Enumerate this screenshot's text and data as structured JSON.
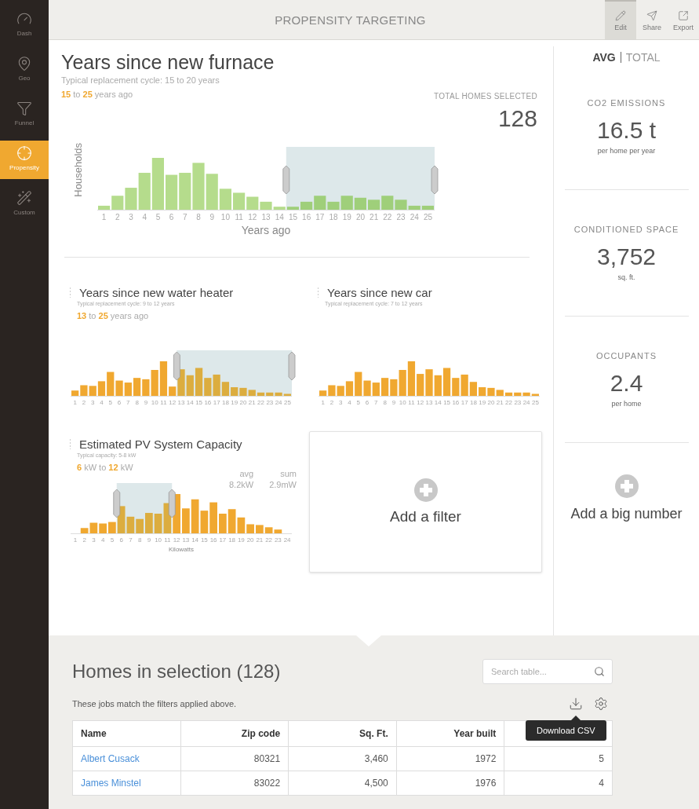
{
  "sidebar": {
    "items": [
      {
        "label": "Dash",
        "kind": "gauge",
        "selected": false
      },
      {
        "label": "Geo",
        "kind": "pin",
        "selected": false
      },
      {
        "label": "Funnel",
        "kind": "funnel",
        "selected": false
      },
      {
        "label": "Propensity",
        "kind": "target",
        "selected": true
      },
      {
        "label": "Custom",
        "kind": "wand",
        "selected": false
      }
    ]
  },
  "header": {
    "title": "PROPENSITY TARGETING",
    "actions": [
      {
        "label": "Edit",
        "kind": "edit",
        "selected": true
      },
      {
        "label": "Share",
        "kind": "share",
        "selected": false
      },
      {
        "label": "Export",
        "kind": "export",
        "selected": false
      }
    ]
  },
  "main_filter": {
    "title": "Years since new furnace",
    "subtitle": "Typical replacement cycle: 15 to 20 years",
    "range": "**15** to **25** years ago",
    "total_label": "TOTAL HOMES SELECTED",
    "total_value": "128",
    "y_axis_label": "Households",
    "x_labels": [
      "1",
      "2",
      "3",
      "4",
      "5",
      "6",
      "7",
      "8",
      "9",
      "10",
      "11",
      "12",
      "13",
      "14",
      "15",
      "16",
      "17",
      "18",
      "19",
      "20",
      "21",
      "22",
      "23",
      "24",
      "25"
    ],
    "x_axis_label": "Years ago"
  },
  "filters": [
    {
      "title": "Years since new water heater",
      "subtitle": "Typical replacement cycle: 9 to 12 years",
      "range": "**13** to **25** years ago",
      "x_labels": [
        "1",
        "2",
        "3",
        "4",
        "5",
        "6",
        "7",
        "8",
        "9",
        "10",
        "11",
        "12",
        "13",
        "14",
        "15",
        "16",
        "17",
        "18",
        "19",
        "20",
        "21",
        "22",
        "23",
        "24",
        "25"
      ]
    },
    {
      "title": "Years since new car",
      "subtitle": "Typical replacement cycle: 7 to 12 years",
      "x_labels": [
        "1",
        "2",
        "3",
        "4",
        "5",
        "6",
        "7",
        "8",
        "9",
        "10",
        "11",
        "12",
        "13",
        "14",
        "15",
        "16",
        "17",
        "18",
        "19",
        "20",
        "21",
        "22",
        "23",
        "24",
        "25"
      ]
    },
    {
      "title": "Estimated PV System Capacity",
      "subtitle": "Typical capacity: 5-8 kW",
      "range": "**6** kW to **12** kW",
      "stats": [
        {
          "label": "avg",
          "value": "8.2kW"
        },
        {
          "label": "sum",
          "value": "2.9mW"
        }
      ],
      "x_labels": [
        "1",
        "2",
        "3",
        "4",
        "5",
        "6",
        "7",
        "8",
        "9",
        "10",
        "11",
        "12",
        "13",
        "14",
        "15",
        "16",
        "17",
        "18",
        "19",
        "20",
        "21",
        "22",
        "23",
        "24"
      ],
      "x_axis_label": "Kilowatts"
    }
  ],
  "add_filter": {
    "label": "Add a filter"
  },
  "summary": {
    "toggle": [
      {
        "label": "AVG",
        "selected": true
      },
      {
        "label": "TOTAL",
        "selected": false
      }
    ],
    "metrics": [
      {
        "label": "CO2 EMISSIONS",
        "value": "16.5 t",
        "unit": "per home per year"
      },
      {
        "label": "CONDITIONED SPACE",
        "value": "3,752",
        "unit": "sq. ft."
      },
      {
        "label": "OCCUPANTS",
        "value": "2.4",
        "unit": "per home"
      }
    ],
    "add_label": "Add a big number"
  },
  "table_section": {
    "title": "Homes in selection (128)",
    "search_placeholder": "Search table...",
    "note": "These jobs match the filters applied above.",
    "tooltip": "Download CSV",
    "columns": [
      "Name",
      "Zip code",
      "Sq. Ft.",
      "Year built"
    ],
    "rows": [
      [
        "Albert Cusack",
        "80321",
        "3,460",
        "1972",
        "5"
      ],
      [
        "James Minstel",
        "83022",
        "4,500",
        "1976",
        "4"
      ]
    ]
  }
}
